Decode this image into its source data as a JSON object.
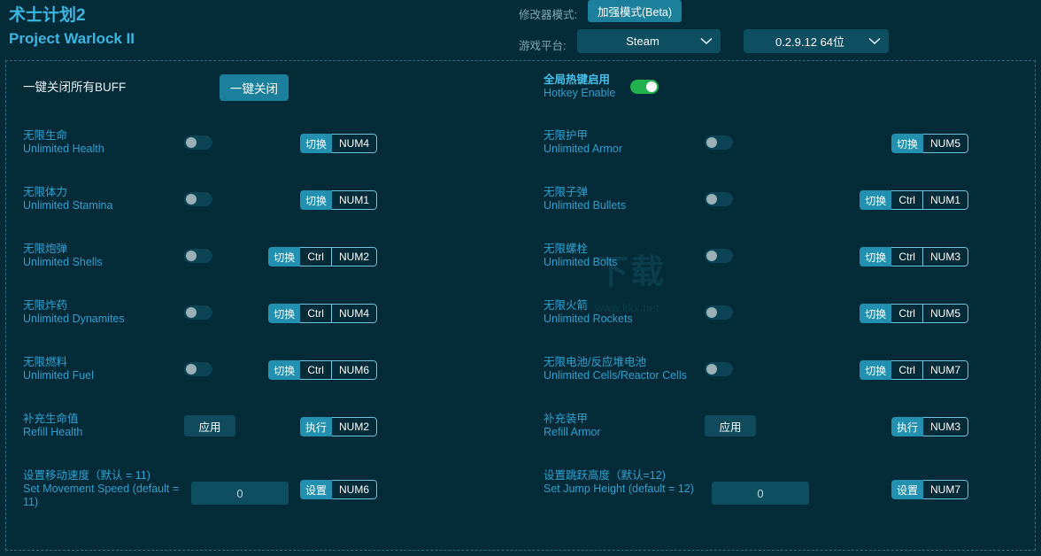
{
  "header": {
    "title_cn": "术士计划2",
    "title_en": "Project Warlock II",
    "mode_label": "修改器模式:",
    "mode_button": "加强模式(Beta)",
    "platform_label": "游戏平台:",
    "platform_value": "Steam",
    "version_value": "0.2.9.12 64位",
    "accent": "#2390b0",
    "brand": "#39b7e0"
  },
  "watermark": {
    "text": "下载",
    "sub": "www.kkx.net"
  },
  "top_controls": {
    "buff_label_cn": "一键关闭所有BUFF",
    "buff_button": "一键关闭",
    "hotkey_cn": "全局热键启用",
    "hotkey_en": "Hotkey Enable",
    "hotkey_state": "on",
    "toggle_on_color": "#22b14c"
  },
  "rows": [
    {
      "cn": "无限生命",
      "en": "Unlimited Health",
      "control": "toggle",
      "state": "off",
      "hotkey": {
        "action": "切换",
        "keys": [
          "NUM4"
        ]
      }
    },
    {
      "cn": "无限护甲",
      "en": "Unlimited Armor",
      "control": "toggle",
      "state": "off",
      "hotkey": {
        "action": "切换",
        "keys": [
          "NUM5"
        ]
      }
    },
    {
      "cn": "无限体力",
      "en": "Unlimited Stamina",
      "control": "toggle",
      "state": "off",
      "hotkey": {
        "action": "切换",
        "keys": [
          "NUM1"
        ]
      }
    },
    {
      "cn": "无限子弹",
      "en": "Unlimited Bullets",
      "control": "toggle",
      "state": "off",
      "hotkey": {
        "action": "切换",
        "keys": [
          "Ctrl",
          "NUM1"
        ]
      }
    },
    {
      "cn": "无限炮弹",
      "en": "Unlimited Shells",
      "control": "toggle",
      "state": "off",
      "hotkey": {
        "action": "切换",
        "keys": [
          "Ctrl",
          "NUM2"
        ]
      }
    },
    {
      "cn": "无限螺栓",
      "en": "Unlimited Bolts",
      "control": "toggle",
      "state": "off",
      "hotkey": {
        "action": "切换",
        "keys": [
          "Ctrl",
          "NUM3"
        ]
      }
    },
    {
      "cn": "无限炸药",
      "en": "Unlimited Dynamites",
      "control": "toggle",
      "state": "off",
      "hotkey": {
        "action": "切换",
        "keys": [
          "Ctrl",
          "NUM4"
        ]
      }
    },
    {
      "cn": "无限火箭",
      "en": "Unlimited Rockets",
      "control": "toggle",
      "state": "off",
      "hotkey": {
        "action": "切换",
        "keys": [
          "Ctrl",
          "NUM5"
        ]
      }
    },
    {
      "cn": "无限燃料",
      "en": "Unlimited Fuel",
      "control": "toggle",
      "state": "off",
      "hotkey": {
        "action": "切换",
        "keys": [
          "Ctrl",
          "NUM6"
        ]
      }
    },
    {
      "cn": "无限电池/反应堆电池",
      "en": "Unlimited Cells/Reactor Cells",
      "control": "toggle",
      "state": "off",
      "hotkey": {
        "action": "切换",
        "keys": [
          "Ctrl",
          "NUM7"
        ]
      }
    },
    {
      "cn": "补充生命值",
      "en": "Refill Health",
      "control": "button",
      "button_label": "应用",
      "hotkey": {
        "action": "执行",
        "keys": [
          "NUM2"
        ]
      }
    },
    {
      "cn": "补充装甲",
      "en": "Refill Armor",
      "control": "button",
      "button_label": "应用",
      "hotkey": {
        "action": "执行",
        "keys": [
          "NUM3"
        ]
      }
    },
    {
      "cn": "设置移动速度（默认 = 11)",
      "en": "Set Movement Speed (default = 11)",
      "control": "input",
      "value": "0",
      "hotkey": {
        "action": "设置",
        "keys": [
          "NUM6"
        ]
      }
    },
    {
      "cn": "设置跳跃高度（默认=12)",
      "en": "Set Jump Height (default = 12)",
      "control": "input",
      "value": "0",
      "hotkey": {
        "action": "设置",
        "keys": [
          "NUM7"
        ]
      }
    }
  ]
}
